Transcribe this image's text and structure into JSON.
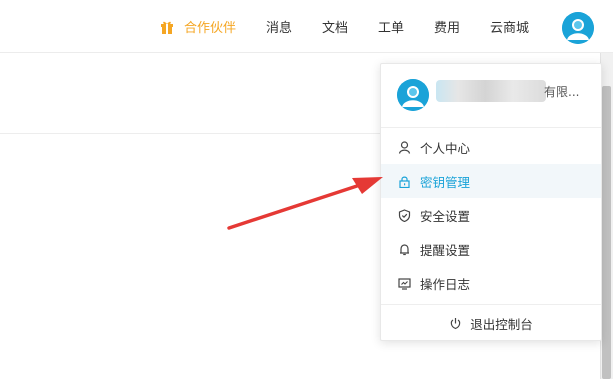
{
  "topbar": {
    "nav": [
      {
        "label": "合作伙伴",
        "icon": "gift-icon"
      },
      {
        "label": "消息"
      },
      {
        "label": "文档"
      },
      {
        "label": "工单"
      },
      {
        "label": "费用"
      },
      {
        "label": "云商城"
      }
    ],
    "avatar_icon": "user-avatar-icon"
  },
  "dropdown": {
    "org_suffix": "有限...",
    "items": [
      {
        "label": "个人中心",
        "icon": "user-icon"
      },
      {
        "label": "密钥管理",
        "icon": "lock-icon"
      },
      {
        "label": "安全设置",
        "icon": "shield-icon"
      },
      {
        "label": "提醒设置",
        "icon": "bell-icon"
      },
      {
        "label": "操作日志",
        "icon": "monitor-icon"
      }
    ],
    "logout_label": "退出控制台",
    "logout_icon": "power-icon"
  },
  "colors": {
    "accent": "#1aa3d8",
    "partner": "#f5a623",
    "annotation_arrow": "#e53935"
  }
}
